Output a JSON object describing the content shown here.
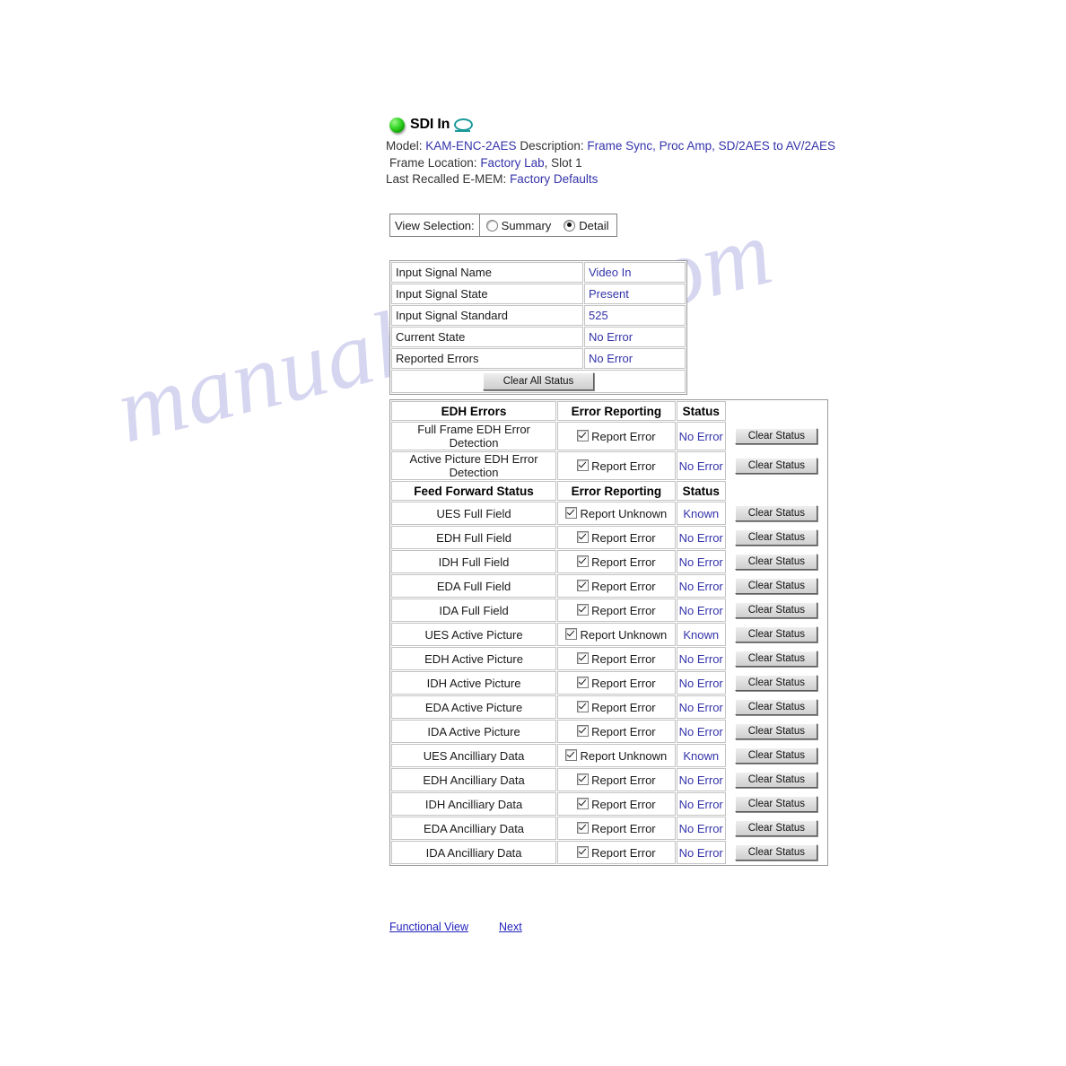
{
  "header": {
    "led_icon": "green-status-led",
    "title": "SDI In",
    "link_icon": "lasso-link-icon",
    "model_label": "Model:",
    "model_value": "KAM-ENC-2AES",
    "description_label": "Description:",
    "description_value": "Frame Sync, Proc Amp, SD/2AES to AV/2AES",
    "frame_location_label": "Frame Location:",
    "frame_location_value": "Factory Lab",
    "slot_text": ", Slot 1",
    "emem_label": "Last Recalled E-MEM:",
    "emem_value": "Factory Defaults"
  },
  "view_selection": {
    "label": "View Selection:",
    "options": [
      {
        "label": "Summary",
        "selected": false
      },
      {
        "label": "Detail",
        "selected": true
      }
    ]
  },
  "signal_status": {
    "rows": [
      {
        "label": "Input Signal Name",
        "value": "Video In"
      },
      {
        "label": "Input Signal State",
        "value": "Present"
      },
      {
        "label": "Input Signal Standard",
        "value": "525"
      },
      {
        "label": "Current State",
        "value": "No Error"
      },
      {
        "label": "Reported Errors",
        "value": "No Error"
      }
    ],
    "clear_all_button": "Clear All Status"
  },
  "edh_table": {
    "section1_headers": {
      "name": "EDH Errors",
      "reporting": "Error Reporting",
      "status": "Status",
      "action": ""
    },
    "section2_headers": {
      "name": "Feed Forward Status",
      "reporting": "Error Reporting",
      "status": "Status",
      "action": ""
    },
    "clear_button": "Clear Status",
    "section1_rows": [
      {
        "name": "Full Frame EDH Error Detection",
        "reporting": "Report Error",
        "checked": true,
        "status": "No Error"
      },
      {
        "name": "Active Picture EDH Error Detection",
        "reporting": "Report Error",
        "checked": true,
        "status": "No Error"
      }
    ],
    "section2_rows": [
      {
        "name": "UES Full Field",
        "reporting": "Report Unknown",
        "checked": true,
        "status": "Known"
      },
      {
        "name": "EDH Full Field",
        "reporting": "Report Error",
        "checked": true,
        "status": "No Error"
      },
      {
        "name": "IDH Full Field",
        "reporting": "Report Error",
        "checked": true,
        "status": "No Error"
      },
      {
        "name": "EDA Full Field",
        "reporting": "Report Error",
        "checked": true,
        "status": "No Error"
      },
      {
        "name": "IDA Full Field",
        "reporting": "Report Error",
        "checked": true,
        "status": "No Error"
      },
      {
        "name": "UES Active Picture",
        "reporting": "Report Unknown",
        "checked": true,
        "status": "Known"
      },
      {
        "name": "EDH Active Picture",
        "reporting": "Report Error",
        "checked": true,
        "status": "No Error"
      },
      {
        "name": "IDH Active Picture",
        "reporting": "Report Error",
        "checked": true,
        "status": "No Error"
      },
      {
        "name": "EDA Active Picture",
        "reporting": "Report Error",
        "checked": true,
        "status": "No Error"
      },
      {
        "name": "IDA Active Picture",
        "reporting": "Report Error",
        "checked": true,
        "status": "No Error"
      },
      {
        "name": "UES Ancilliary Data",
        "reporting": "Report Unknown",
        "checked": true,
        "status": "Known"
      },
      {
        "name": "EDH Ancilliary Data",
        "reporting": "Report Error",
        "checked": true,
        "status": "No Error"
      },
      {
        "name": "IDH Ancilliary Data",
        "reporting": "Report Error",
        "checked": true,
        "status": "No Error"
      },
      {
        "name": "EDA Ancilliary Data",
        "reporting": "Report Error",
        "checked": true,
        "status": "No Error"
      },
      {
        "name": "IDA Ancilliary Data",
        "reporting": "Report Error",
        "checked": true,
        "status": "No Error"
      }
    ]
  },
  "footer": {
    "links": [
      {
        "label": "Functional View"
      },
      {
        "label": "Next"
      }
    ]
  },
  "watermark": {
    "text": "manualshive.com"
  },
  "colors": {
    "value_blue": "#3333aa",
    "link_blue": "#2222bb",
    "led_green": "#3ddb2e",
    "icon_teal": "#1c9a9a"
  }
}
